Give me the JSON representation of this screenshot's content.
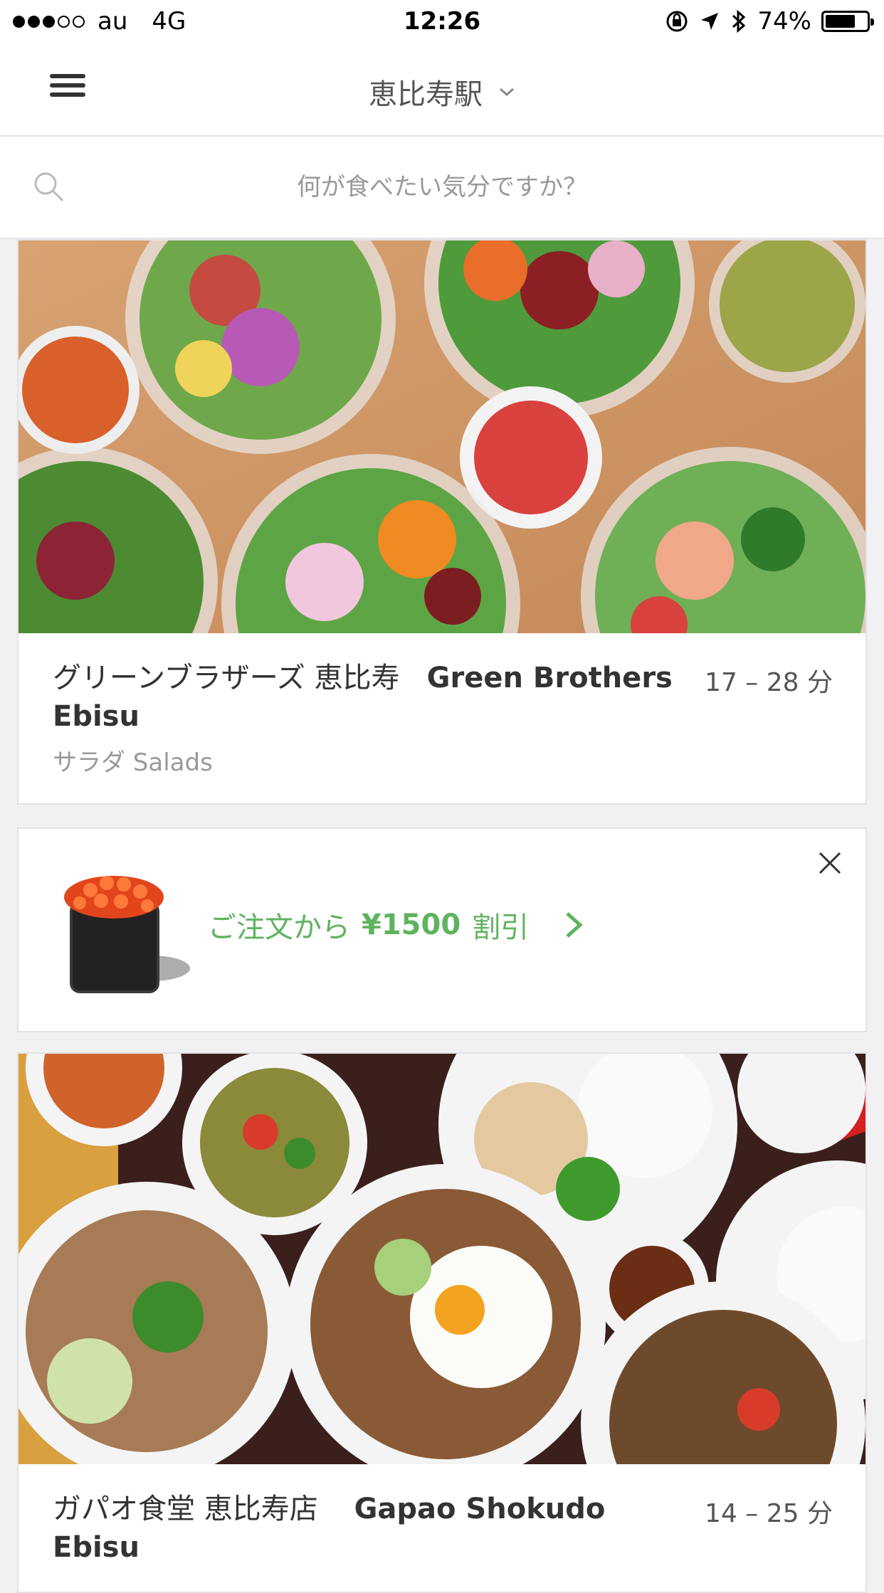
{
  "status_bar": {
    "carrier": "au",
    "network": "4G",
    "time": "12:26",
    "battery": "74%",
    "battery_level": 0.74
  },
  "header": {
    "location": "恵比寿駅",
    "menu_icon": "hamburger-icon",
    "location_icon": "chevron-down-icon"
  },
  "search": {
    "placeholder": "何が食べたい気分ですか？",
    "icon": "search-icon"
  },
  "restaurants": [
    {
      "name_ja": "グリーンブラザーズ 恵比寿",
      "name_en": "Green Brothers Ebisu",
      "time": "17 – 28 分",
      "category": "サラダ Salads"
    },
    {
      "name_ja": "ガパオ食堂 恵比寿店",
      "name_en": "Gapao Shokudo Ebisu",
      "time": "14 – 25 分",
      "category": ""
    }
  ],
  "promo": {
    "prefix": "ご注文から",
    "amount": "¥1500",
    "suffix": "割引",
    "close_icon": "close-icon",
    "arrow_icon": "chevron-right-icon"
  },
  "colors": {
    "accent_green": "#5fb35f",
    "background": "#f1f1f4"
  }
}
